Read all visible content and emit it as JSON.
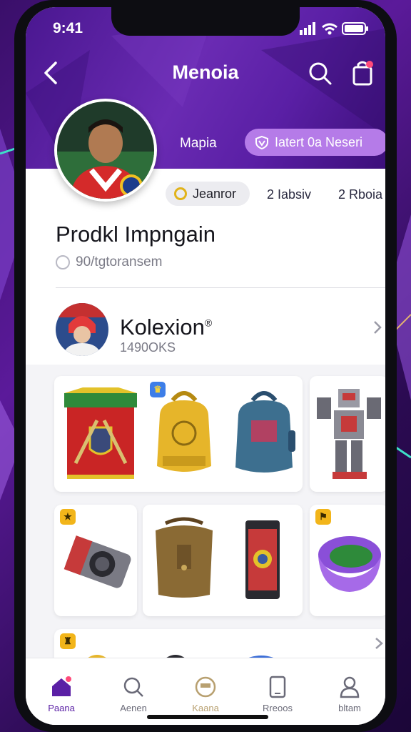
{
  "status_bar": {
    "time": "9:41"
  },
  "header": {
    "title": "Menoia"
  },
  "hero": {
    "link_label": "Mapia",
    "pill_label": "Iatert 0a Neseri"
  },
  "profile": {
    "chip_label": "Jeanror",
    "stat_1": "2 Iabsiv",
    "stat_2": "2 Rboia",
    "title": "Prodkl Impngain",
    "subtitle": "90/tgtoransem"
  },
  "collection": {
    "title": "Kolexion",
    "mark": "®",
    "count": "1490OKS"
  },
  "tabs": [
    {
      "label": "Paana"
    },
    {
      "label": "Aenen"
    },
    {
      "label": "Kaana"
    },
    {
      "label": "Rreoos"
    },
    {
      "label": "bltam"
    }
  ],
  "colors": {
    "accent": "#6a2bb3",
    "pill": "#b57be8",
    "active_tab": "#5a1fa5"
  }
}
